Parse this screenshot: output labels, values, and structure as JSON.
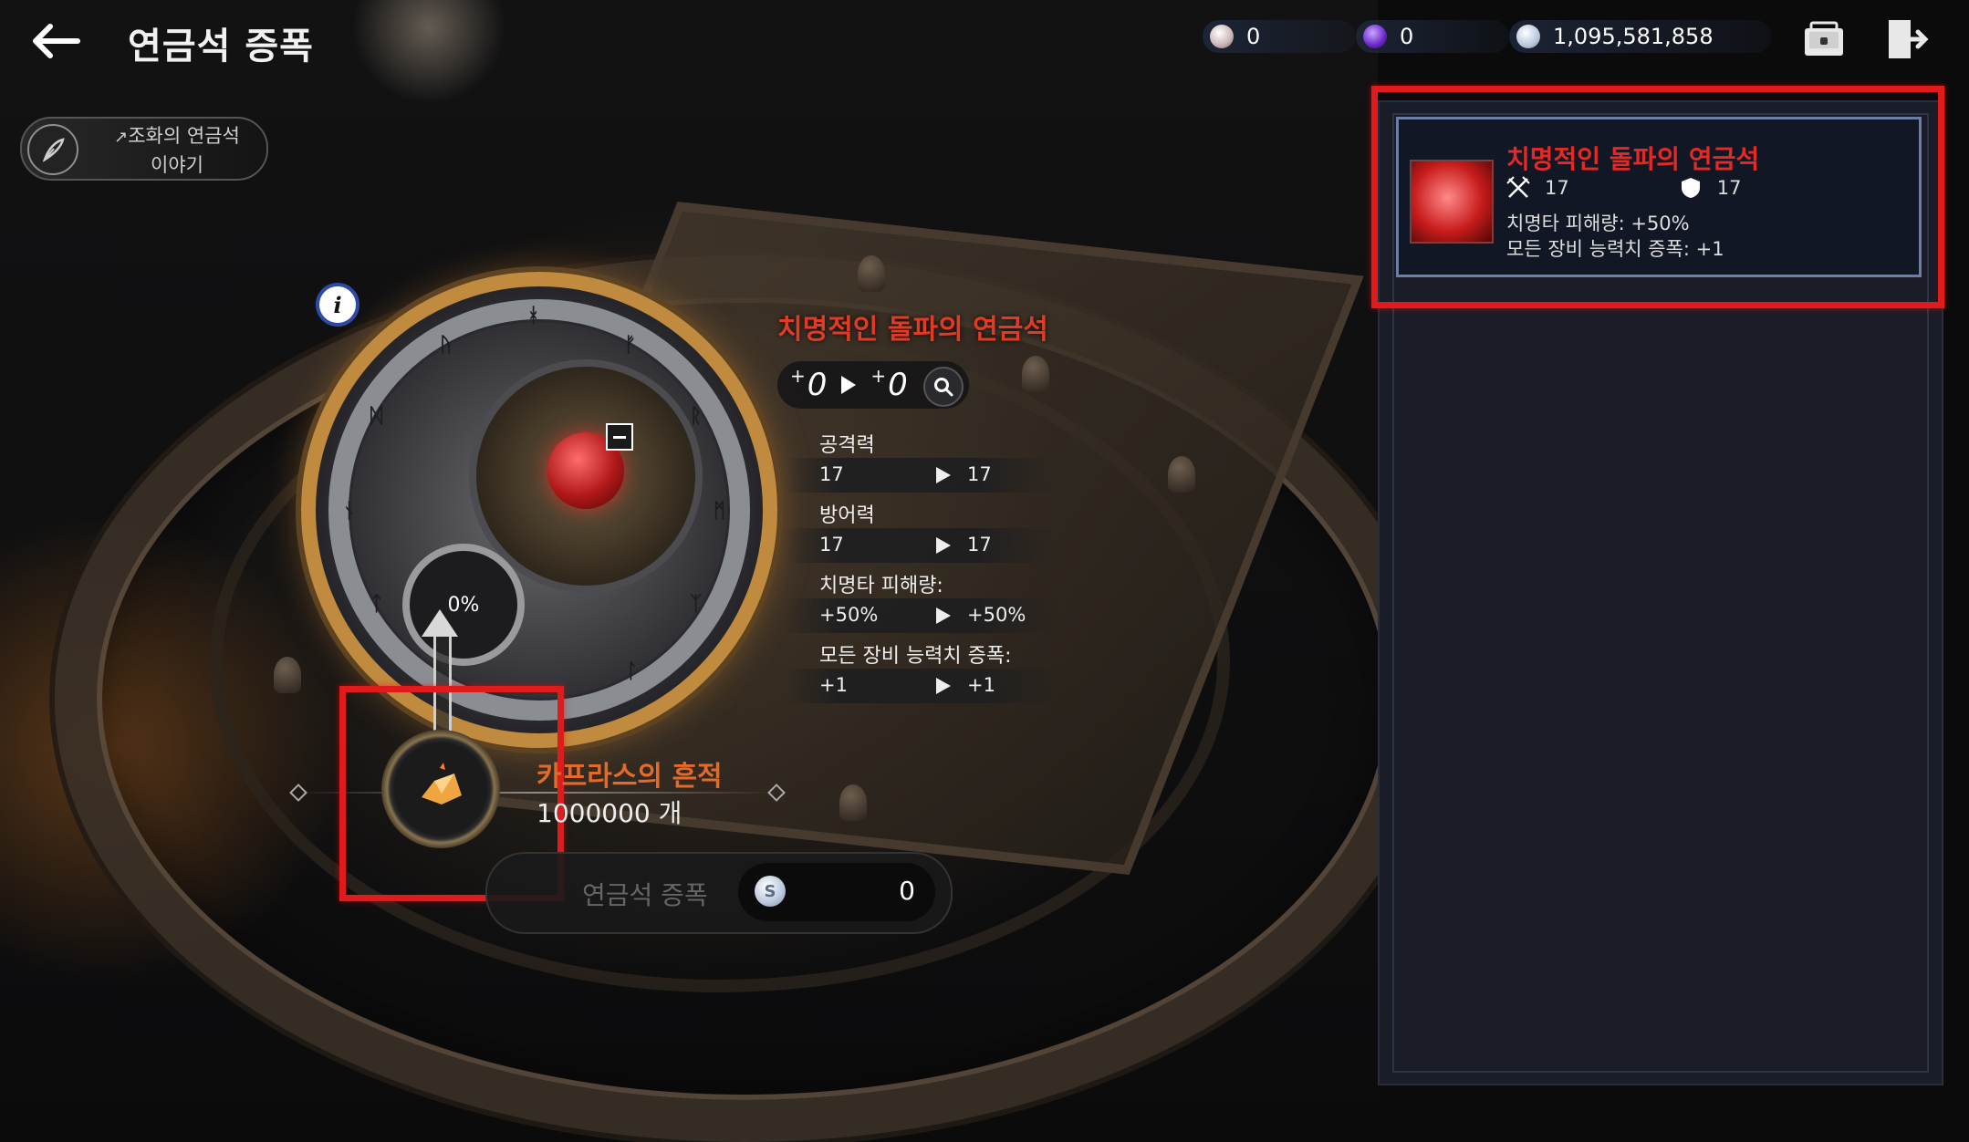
{
  "header": {
    "title": "연금석 증폭",
    "currencies": [
      {
        "icon": "pearl-orb-icon",
        "color": "#d8c4c4",
        "value": "0"
      },
      {
        "icon": "purple-orb-icon",
        "color": "#7b3fd8",
        "value": "0"
      },
      {
        "icon": "silver-coin-icon",
        "color": "#c9d3e6",
        "value": "1,095,581,858"
      }
    ]
  },
  "story": {
    "line1": "조화의 연금석",
    "line2": "이야기"
  },
  "dial": {
    "progress": "0%",
    "runes": [
      "ᚼ",
      "ᚠ",
      "ᚱ",
      "ᛗ",
      "ᛉ",
      "ᛚ",
      "ᚢ",
      "ᛞ",
      "ᚾ",
      "ᛏ",
      "ᛒ",
      "ᛟ"
    ]
  },
  "stone": {
    "name": "치명적인 돌파의 연금석",
    "level_from": "0",
    "level_to": "0",
    "stats": [
      {
        "label": "공격력",
        "from": "17",
        "to": "17"
      },
      {
        "label": "방어력",
        "from": "17",
        "to": "17"
      },
      {
        "label": "치명타 피해량:",
        "from": "+50%",
        "to": "+50%"
      },
      {
        "label": "모든 장비 능력치 증폭:",
        "from": "+1",
        "to": "+1"
      }
    ]
  },
  "material": {
    "name": "카프라스의 흔적",
    "count": "1000000 개"
  },
  "action": {
    "label": "연금석 증폭",
    "cost": "0"
  },
  "panel": {
    "card": {
      "name": "치명적인 돌파의 연금석",
      "attack": "17",
      "defense": "17",
      "effect1": "치명타 피해량: +50%",
      "effect2": "모든 장비 능력치 증폭: +1"
    }
  },
  "colors": {
    "highlight": "#e11b1b",
    "stone_name": "#e13a25",
    "material_name": "#e46a2a",
    "panel_bg": "#1a1d27"
  }
}
